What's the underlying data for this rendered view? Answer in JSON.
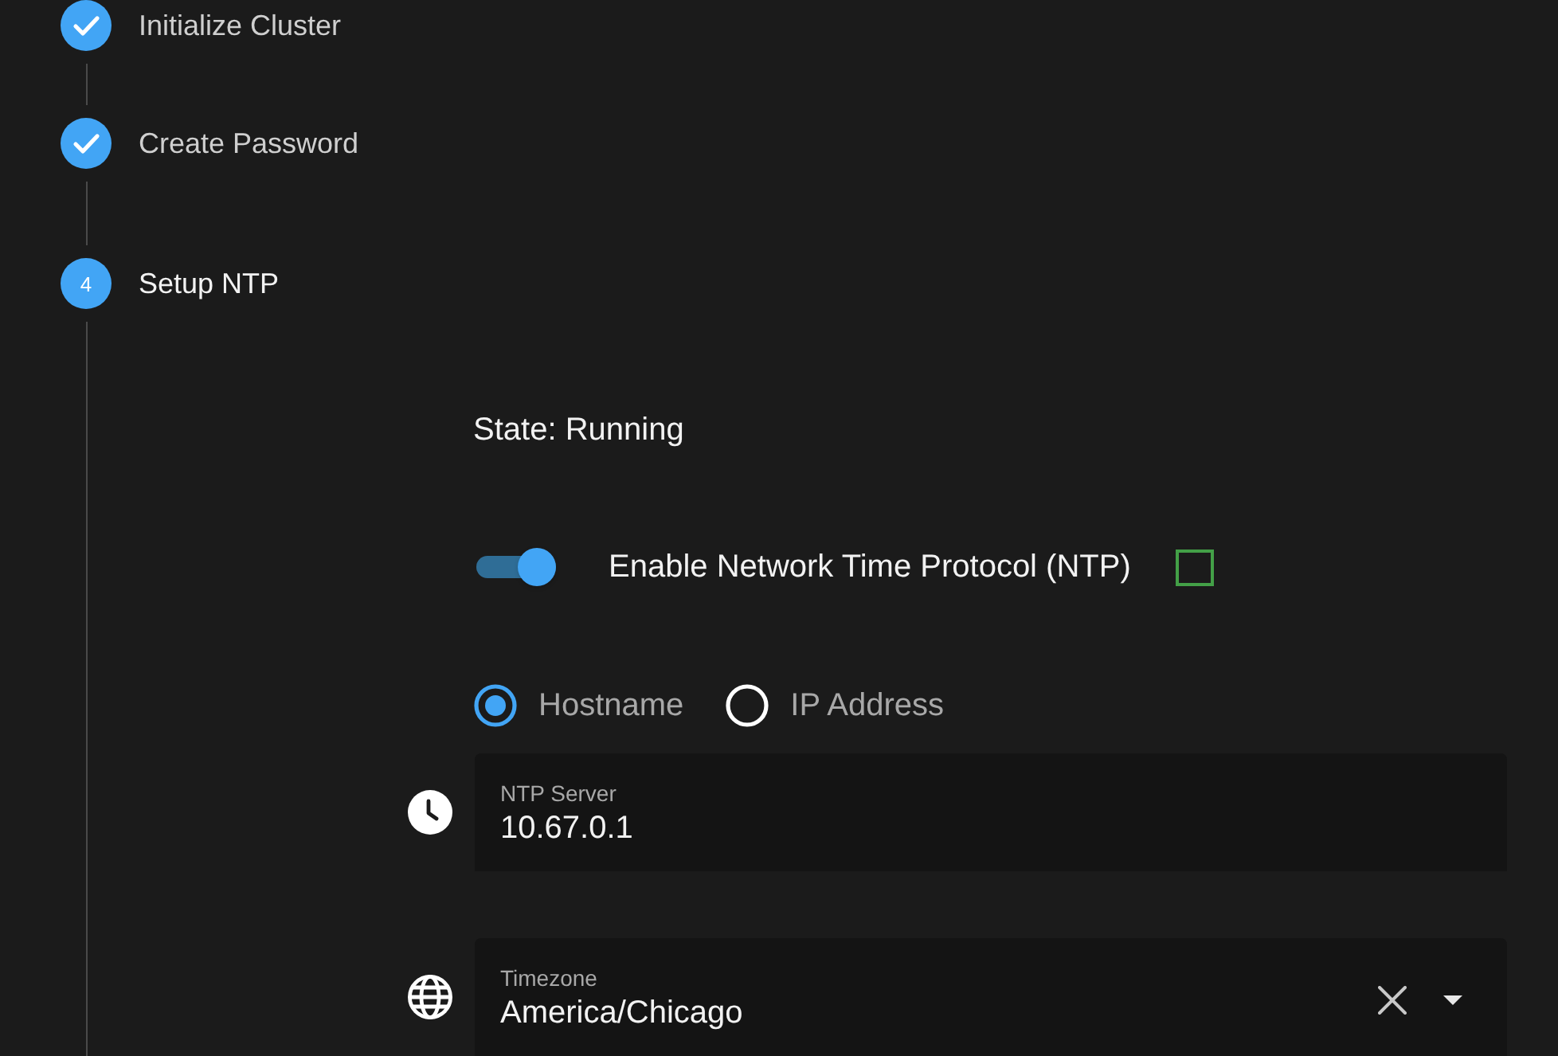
{
  "stepper": {
    "steps": [
      {
        "label": "Initialize Cluster",
        "completed": true
      },
      {
        "label": "Create Password",
        "completed": true
      },
      {
        "label": "Setup NTP",
        "completed": false,
        "number": "4"
      }
    ]
  },
  "ntp": {
    "state": "State: Running",
    "enabled": true,
    "label": "Enable Network Time Protocol (NTP)"
  },
  "server_type": {
    "options": [
      {
        "label": "Hostname",
        "selected": true
      },
      {
        "label": "IP Address",
        "selected": false
      }
    ]
  },
  "fields": [
    {
      "kind": "text",
      "label": "NTP Server",
      "value": "10.67.0.1"
    },
    {
      "kind": "select",
      "label": "Timezone",
      "value": "America/Chicago"
    }
  ]
}
